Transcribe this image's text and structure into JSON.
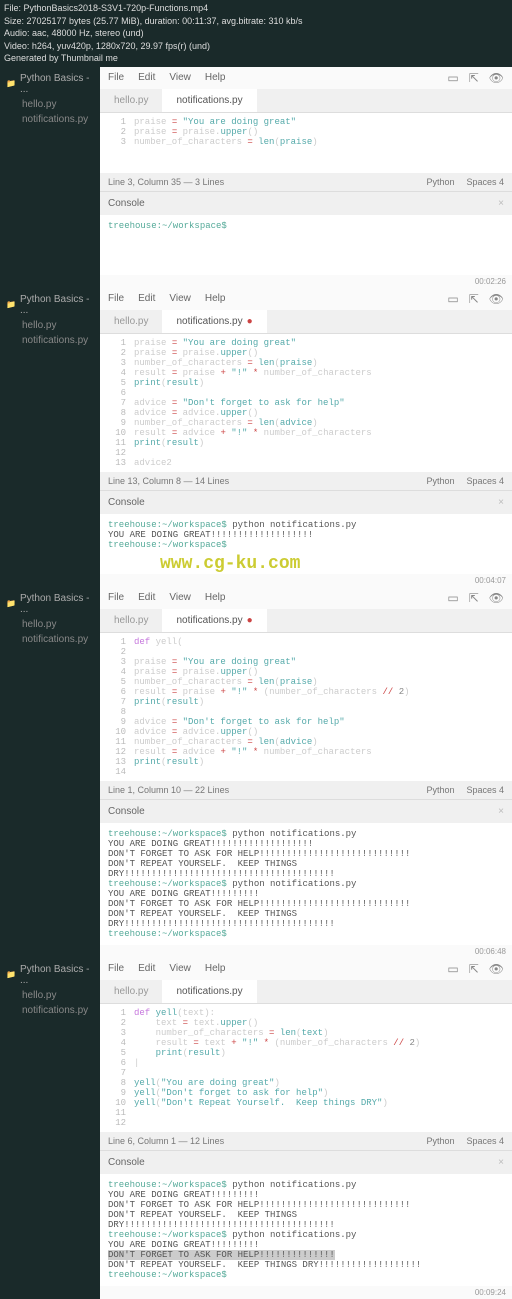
{
  "meta": {
    "file": "File: PythonBasics2018-S3V1-720p-Functions.mp4",
    "size": "Size: 27025177 bytes (25.77 MiB), duration: 00:11:37, avg.bitrate: 310 kb/s",
    "audio": "Audio: aac, 48000 Hz, stereo (und)",
    "video": "Video: h264, yuv420p, 1280x720, 29.97 fps(r) (und)",
    "gen": "Generated by Thumbnail me"
  },
  "watermark": "www.cg-ku.com",
  "menu": {
    "file": "File",
    "edit": "Edit",
    "view": "View",
    "help": "Help"
  },
  "sidebar": {
    "folder": "Python Basics - ...",
    "files": [
      "hello.py",
      "notifications.py"
    ]
  },
  "tabs": {
    "hello": "hello.py",
    "notif": "notifications.py"
  },
  "console_label": "Console",
  "panels": [
    {
      "code": [
        {
          "n": 1,
          "html": "praise <span class='op'>=</span> <span class='str'>\"You are doing great\"</span>"
        },
        {
          "n": 2,
          "html": "praise <span class='op'>=</span> praise.<span class='fn'>upper</span>()"
        },
        {
          "n": 3,
          "html": "number_of_characters <span class='op'>=</span> <span class='fn'>len</span>(<span class='id'>praise</span>)"
        }
      ],
      "status_left": "Line 3, Column 35 — 3 Lines",
      "status_lang": "Python",
      "status_spaces": "Spaces  4",
      "console": "<span class='prompt'>treehouse:~/workspace$</span> ",
      "ts": "00:02:26",
      "modified": false
    },
    {
      "code": [
        {
          "n": 1,
          "html": "praise <span class='op'>=</span> <span class='str'>\"You are doing great\"</span>"
        },
        {
          "n": 2,
          "html": "praise <span class='op'>=</span> praise.<span class='fn'>upper</span>()"
        },
        {
          "n": 3,
          "html": "number_of_characters <span class='op'>=</span> <span class='fn'>len</span>(<span class='id'>praise</span>)"
        },
        {
          "n": 4,
          "html": "result <span class='op'>=</span> praise <span class='op'>+</span> <span class='str'>\"!\"</span> <span class='op'>*</span> number_of_characters"
        },
        {
          "n": 5,
          "html": "<span class='fn'>print</span>(<span class='id'>result</span>)"
        },
        {
          "n": 6,
          "html": ""
        },
        {
          "n": 7,
          "html": "advice <span class='op'>=</span> <span class='str'>\"Don't forget to ask for help\"</span>"
        },
        {
          "n": 8,
          "html": "advice <span class='op'>=</span> advice.<span class='fn'>upper</span>()"
        },
        {
          "n": 9,
          "html": "number_of_characters <span class='op'>=</span> <span class='fn'>len</span>(<span class='id'>advice</span>)"
        },
        {
          "n": 10,
          "html": "result <span class='op'>=</span> advice <span class='op'>+</span> <span class='str'>\"!\"</span> <span class='op'>*</span> number_of_characters"
        },
        {
          "n": 11,
          "html": "<span class='fn'>print</span>(<span class='id'>result</span>)"
        },
        {
          "n": 12,
          "html": ""
        },
        {
          "n": 13,
          "html": "advice2"
        }
      ],
      "status_left": "Line 13, Column 8 — 14 Lines",
      "status_lang": "Python",
      "status_spaces": "Spaces  4",
      "console": "<span class='prompt'>treehouse:~/workspace$</span> python notifications.py\nYOU ARE DOING GREAT!!!!!!!!!!!!!!!!!!!\n<span class='prompt'>treehouse:~/workspace$</span> ",
      "ts": "00:04:07",
      "modified": true
    },
    {
      "code": [
        {
          "n": 1,
          "html": "<span class='kw'>def</span> yell("
        },
        {
          "n": 2,
          "html": ""
        },
        {
          "n": 3,
          "html": "praise <span class='op'>=</span> <span class='str'>\"You are doing great\"</span>"
        },
        {
          "n": 4,
          "html": "praise <span class='op'>=</span> praise.<span class='fn'>upper</span>()"
        },
        {
          "n": 5,
          "html": "number_of_characters <span class='op'>=</span> <span class='fn'>len</span>(<span class='id'>praise</span>)"
        },
        {
          "n": 6,
          "html": "result <span class='op'>=</span> praise <span class='op'>+</span> <span class='str'>\"!\"</span> <span class='op'>*</span> (number_of_characters <span class='op'>//</span> <span class='num'>2</span>)"
        },
        {
          "n": 7,
          "html": "<span class='fn'>print</span>(<span class='id'>result</span>)"
        },
        {
          "n": 8,
          "html": ""
        },
        {
          "n": 9,
          "html": "advice <span class='op'>=</span> <span class='str'>\"Don't forget to ask for help\"</span>"
        },
        {
          "n": 10,
          "html": "advice <span class='op'>=</span> advice.<span class='fn'>upper</span>()"
        },
        {
          "n": 11,
          "html": "number_of_characters <span class='op'>=</span> <span class='fn'>len</span>(<span class='id'>advice</span>)"
        },
        {
          "n": 12,
          "html": "result <span class='op'>=</span> advice <span class='op'>+</span> <span class='str'>\"!\"</span> <span class='op'>*</span> number_of_characters"
        },
        {
          "n": 13,
          "html": "<span class='fn'>print</span>(<span class='id'>result</span>)"
        },
        {
          "n": 14,
          "html": ""
        }
      ],
      "status_left": "Line 1, Column 10 — 22 Lines",
      "status_lang": "Python",
      "status_spaces": "Spaces  4",
      "console": "<span class='prompt'>treehouse:~/workspace$</span> python notifications.py\nYOU ARE DOING GREAT!!!!!!!!!!!!!!!!!!!\nDON'T FORGET TO ASK FOR HELP!!!!!!!!!!!!!!!!!!!!!!!!!!!!\nDON'T REPEAT YOURSELF.  KEEP THINGS DRY!!!!!!!!!!!!!!!!!!!!!!!!!!!!!!!!!!!!!!!\n<span class='prompt'>treehouse:~/workspace$</span> python notifications.py\nYOU ARE DOING GREAT!!!!!!!!!\nDON'T FORGET TO ASK FOR HELP!!!!!!!!!!!!!!!!!!!!!!!!!!!!\nDON'T REPEAT YOURSELF.  KEEP THINGS DRY!!!!!!!!!!!!!!!!!!!!!!!!!!!!!!!!!!!!!!!\n<span class='prompt'>treehouse:~/workspace$</span> ",
      "ts": "00:06:48",
      "modified": true
    },
    {
      "code": [
        {
          "n": 1,
          "html": "<span class='kw'>def</span> <span class='fn'>yell</span>(text):"
        },
        {
          "n": 2,
          "html": "    text <span class='op'>=</span> text.<span class='fn'>upper</span>()"
        },
        {
          "n": 3,
          "html": "    number_of_characters <span class='op'>=</span> <span class='fn'>len</span>(<span class='id'>text</span>)"
        },
        {
          "n": 4,
          "html": "    result <span class='op'>=</span> text <span class='op'>+</span> <span class='str'>\"!\"</span> <span class='op'>*</span> (number_of_characters <span class='op'>//</span> <span class='num'>2</span>)"
        },
        {
          "n": 5,
          "html": "    <span class='fn'>print</span>(<span class='id'>result</span>)"
        },
        {
          "n": 6,
          "html": "|"
        },
        {
          "n": 7,
          "html": ""
        },
        {
          "n": 8,
          "html": "<span class='fn'>yell</span>(<span class='str'>\"You are doing great\"</span>)"
        },
        {
          "n": 9,
          "html": "<span class='fn'>yell</span>(<span class='str'>\"Don't forget to ask for help\"</span>)"
        },
        {
          "n": 10,
          "html": "<span class='fn'>yell</span>(<span class='str'>\"Don't Repeat Yourself.  Keep things DRY\"</span>)"
        },
        {
          "n": 11,
          "html": ""
        },
        {
          "n": 12,
          "html": ""
        }
      ],
      "status_left": "Line 6, Column 1 — 12 Lines",
      "status_lang": "Python",
      "status_spaces": "Spaces  4",
      "console": "<span class='prompt'>treehouse:~/workspace$</span> python notifications.py\nYOU ARE DOING GREAT!!!!!!!!!\nDON'T FORGET TO ASK FOR HELP!!!!!!!!!!!!!!!!!!!!!!!!!!!!\nDON'T REPEAT YOURSELF.  KEEP THINGS DRY!!!!!!!!!!!!!!!!!!!!!!!!!!!!!!!!!!!!!!!\n<span class='prompt'>treehouse:~/workspace$</span> python notifications.py\nYOU ARE DOING GREAT!!!!!!!!!\n<span class='hl'>DON'T FORGET TO ASK FOR HELP!!!!!!!!!!!!!!</span>\nDON'T REPEAT YOURSELF.  KEEP THINGS DRY!!!!!!!!!!!!!!!!!!!\n<span class='prompt'>treehouse:~/workspace$</span> ",
      "ts": "00:09:24",
      "modified": false
    }
  ]
}
